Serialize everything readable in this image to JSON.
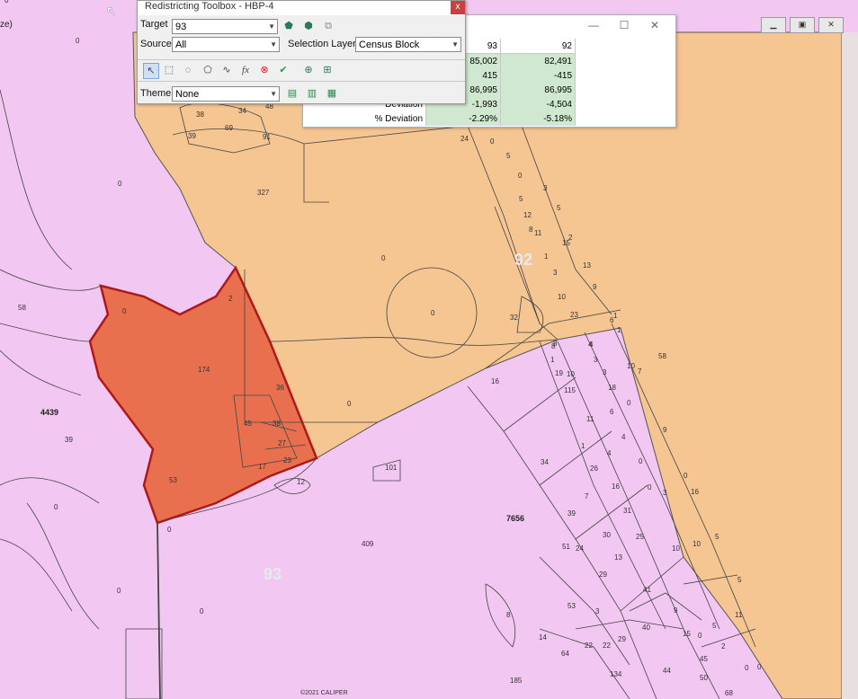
{
  "toolbox": {
    "title": "Redistricting Toolbox - HBP-4",
    "close_label": "x",
    "target_label": "Target",
    "target_value": "93",
    "source_label": "Source",
    "source_value": "All",
    "selection_layer_label": "Selection Layer",
    "selection_layer_value": "Census Block",
    "theme_label": "Theme",
    "theme_value": "None"
  },
  "stats": {
    "col_headers": [
      "93",
      "92"
    ],
    "rows": [
      {
        "label": "",
        "values": [
          "85,002",
          "82,491"
        ]
      },
      {
        "label": "",
        "values": [
          "415",
          "-415"
        ]
      },
      {
        "label": "",
        "values": [
          "86,995",
          "86,995"
        ]
      },
      {
        "label": "Deviation",
        "values": [
          "-1,993",
          "-4,504"
        ]
      },
      {
        "label": "% Deviation",
        "values": [
          "-2.29%",
          "-5.18%"
        ]
      }
    ]
  },
  "window": {
    "left_title_fragment": "ze)"
  },
  "map": {
    "copyright": "©2021 CALIPER",
    "colors": {
      "district_93": "#f2c8f2",
      "district_92": "#f5c592",
      "selection": "#e8704f",
      "selection_border": "#b01818"
    },
    "district_labels": [
      "92",
      "93"
    ],
    "tract_labels": [
      "4439",
      "7656"
    ],
    "block_labels": [
      "0",
      "58",
      "39",
      "0",
      "0",
      "0",
      "0",
      "38",
      "34",
      "48",
      "39",
      "69",
      "91",
      "327",
      "0",
      "0",
      "0",
      "0",
      "2",
      "174",
      "36",
      "45",
      "38",
      "27",
      "23",
      "17",
      "53",
      "0",
      "12",
      "101",
      "34",
      "39",
      "51",
      "24",
      "30",
      "25",
      "13",
      "29",
      "41",
      "53",
      "3",
      "8",
      "14",
      "64",
      "22",
      "22",
      "29",
      "40",
      "9",
      "15",
      "0",
      "11",
      "0",
      "185",
      "134",
      "44",
      "45",
      "50",
      "68",
      "5",
      "2",
      "0",
      "8",
      "4",
      "3",
      "1",
      "10",
      "1",
      "6",
      "10",
      "10",
      "5",
      "5",
      "0",
      "16",
      "10",
      "26",
      "16",
      "7",
      "31",
      "9",
      "1",
      "4",
      "11",
      "0",
      "6",
      "4",
      "3",
      "0",
      "0",
      "8",
      "4",
      "1",
      "19",
      "3",
      "15",
      "18",
      "7",
      "1",
      "32",
      "23",
      "10",
      "9",
      "3",
      "1",
      "15",
      "11",
      "12",
      "8",
      "5",
      "3",
      "5",
      "2",
      "13",
      "0",
      "5",
      "0",
      "24",
      "16",
      "0",
      "58",
      "409"
    ]
  }
}
